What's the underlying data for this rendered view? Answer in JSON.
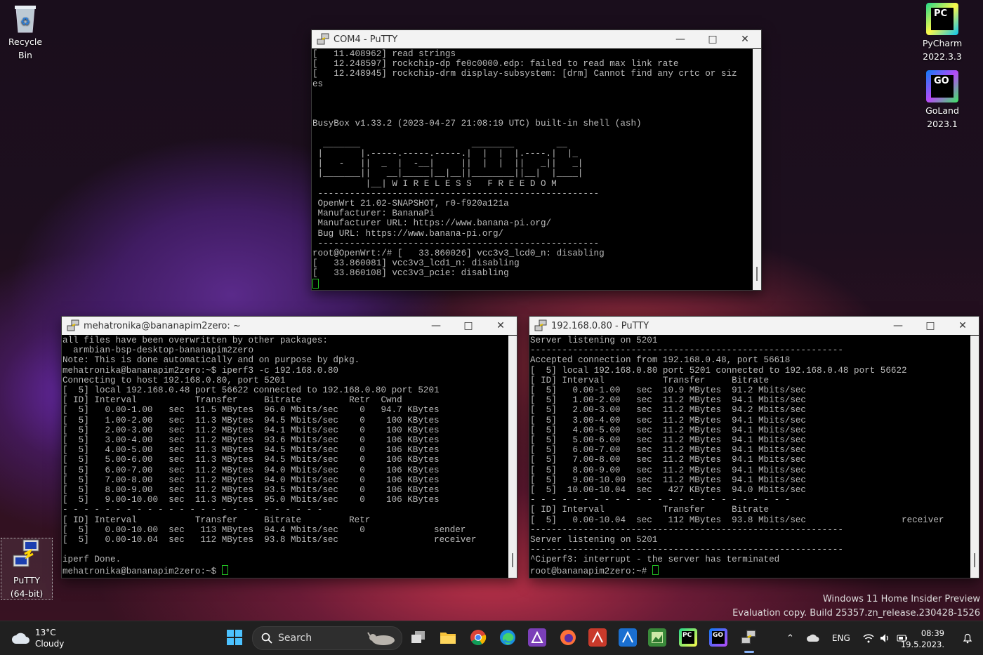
{
  "desktop": {
    "icons": {
      "recycle_bin": "Recycle Bin",
      "pycharm": [
        "PyCharm",
        "2022.3.3"
      ],
      "goland": [
        "GoLand",
        "2023.1"
      ],
      "putty": [
        "PuTTY",
        "(64-bit)"
      ]
    },
    "watermark": {
      "line1": "Windows 11 Home Insider Preview",
      "line2": "Evaluation copy. Build 25357.zn_release.230428-1526"
    }
  },
  "windows": {
    "com4": {
      "title": "COM4 - PuTTY",
      "lines": [
        "[   11.408962] read strings",
        "[   12.248597] rockchip-dp fe0c0000.edp: failed to read max link rate",
        "[   12.248945] rockchip-drm display-subsystem: [drm] Cannot find any crtc or siz",
        "es",
        "",
        "",
        "",
        "BusyBox v1.33.2 (2023-04-27 21:08:19 UTC) built-in shell (ash)",
        "",
        "  _______                     ________        __",
        " |       |.-----.-----.-----.|  |  |  |.----.|  |_",
        " |   -   ||  _  |  -__|     ||  |  |  ||   _||   _|",
        " |_______||   __|_____|__|__||________||__|  |____|",
        "          |__| W I R E L E S S   F R E E D O M",
        " -----------------------------------------------------",
        " OpenWrt 21.02-SNAPSHOT, r0-f920a121a",
        " Manufacturer: BananaPi",
        " Manufacturer URL: https://www.banana-pi.org/",
        " Bug URL: https://www.banana-pi.org/",
        " -----------------------------------------------------",
        "root@OpenWrt:/# [   33.860026] vcc3v3_lcd0_n: disabling",
        "[   33.860081] vcc3v3_lcd1_n: disabling",
        "[   33.860108] vcc3v3_pcie: disabling"
      ]
    },
    "client": {
      "title": "mehatronika@bananapim2zero: ~",
      "lines": [
        "all files have been overwritten by other packages:",
        "  armbian-bsp-desktop-bananapim2zero",
        "Note: This is done automatically and on purpose by dpkg.",
        "mehatronika@bananapim2zero:~$ iperf3 -c 192.168.0.80",
        "Connecting to host 192.168.0.80, port 5201",
        "[  5] local 192.168.0.48 port 56622 connected to 192.168.0.80 port 5201",
        "[ ID] Interval           Transfer     Bitrate         Retr  Cwnd",
        "[  5]   0.00-1.00   sec  11.5 MBytes  96.0 Mbits/sec    0   94.7 KBytes",
        "[  5]   1.00-2.00   sec  11.3 MBytes  94.5 Mbits/sec    0    100 KBytes",
        "[  5]   2.00-3.00   sec  11.2 MBytes  94.1 Mbits/sec    0    100 KBytes",
        "[  5]   3.00-4.00   sec  11.2 MBytes  93.6 Mbits/sec    0    106 KBytes",
        "[  5]   4.00-5.00   sec  11.3 MBytes  94.5 Mbits/sec    0    106 KBytes",
        "[  5]   5.00-6.00   sec  11.3 MBytes  94.5 Mbits/sec    0    106 KBytes",
        "[  5]   6.00-7.00   sec  11.2 MBytes  94.0 Mbits/sec    0    106 KBytes",
        "[  5]   7.00-8.00   sec  11.2 MBytes  94.0 Mbits/sec    0    106 KBytes",
        "[  5]   8.00-9.00   sec  11.2 MBytes  93.5 Mbits/sec    0    106 KBytes",
        "[  5]   9.00-10.00  sec  11.3 MBytes  95.0 Mbits/sec    0    106 KBytes",
        "- - - - - - - - - - - - - - - - - - - - - - - - -",
        "[ ID] Interval           Transfer     Bitrate         Retr",
        "[  5]   0.00-10.00  sec   113 MBytes  94.4 Mbits/sec    0             sender",
        "[  5]   0.00-10.04  sec   112 MBytes  93.8 Mbits/sec                  receiver",
        "",
        "iperf Done.",
        "mehatronika@bananapim2zero:~$ "
      ]
    },
    "server": {
      "title": "192.168.0.80 - PuTTY",
      "lines": [
        "Server listening on 5201",
        "-----------------------------------------------------------",
        "Accepted connection from 192.168.0.48, port 56618",
        "[  5] local 192.168.0.80 port 5201 connected to 192.168.0.48 port 56622",
        "[ ID] Interval           Transfer     Bitrate",
        "[  5]   0.00-1.00   sec  10.9 MBytes  91.2 Mbits/sec",
        "[  5]   1.00-2.00   sec  11.2 MBytes  94.1 Mbits/sec",
        "[  5]   2.00-3.00   sec  11.2 MBytes  94.2 Mbits/sec",
        "[  5]   3.00-4.00   sec  11.2 MBytes  94.1 Mbits/sec",
        "[  5]   4.00-5.00   sec  11.2 MBytes  94.1 Mbits/sec",
        "[  5]   5.00-6.00   sec  11.2 MBytes  94.1 Mbits/sec",
        "[  5]   6.00-7.00   sec  11.2 MBytes  94.1 Mbits/sec",
        "[  5]   7.00-8.00   sec  11.2 MBytes  94.1 Mbits/sec",
        "[  5]   8.00-9.00   sec  11.2 MBytes  94.1 Mbits/sec",
        "[  5]   9.00-10.00  sec  11.2 MBytes  94.1 Mbits/sec",
        "[  5]  10.00-10.04  sec   427 KBytes  94.0 Mbits/sec",
        "- - - - - - - - - - - - - - - - - - - - - - - - -",
        "[ ID] Interval           Transfer     Bitrate",
        "[  5]   0.00-10.04  sec   112 MBytes  93.8 Mbits/sec                  receiver",
        "-----------------------------------------------------------",
        "Server listening on 5201",
        "-----------------------------------------------------------",
        "^Ciperf3: interrupt - the server has terminated",
        "root@bananapim2zero:~# "
      ]
    }
  },
  "taskbar": {
    "weather": {
      "temp": "13°C",
      "condition": "Cloudy"
    },
    "search_label": "Search",
    "language": "ENG",
    "time": "08:39",
    "date": "19.5.2023."
  },
  "colors": {
    "terminal_bg": "#000000",
    "terminal_fg": "#bbbbbb",
    "cursor": "#22c122",
    "taskbar": "#202020"
  }
}
